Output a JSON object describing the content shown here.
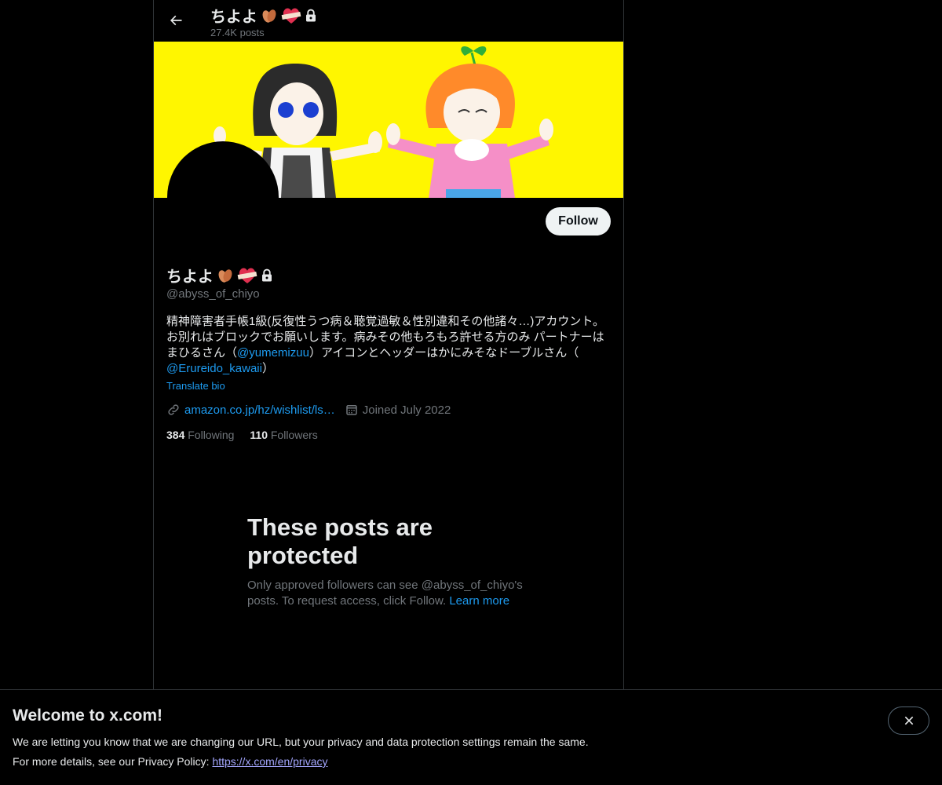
{
  "header": {
    "name": "ちよよ",
    "post_count": "27.4K posts"
  },
  "profile": {
    "name": "ちよよ",
    "handle": "@abyss_of_chiyo",
    "follow_label": "Follow",
    "bio_line1": "精神障害者手帳1級(反復性うつ病＆聴覚過敏＆性別違和その他諸々…)アカウント。",
    "bio_line2": "お別れはブロックでお願いします。病みその他もろもろ許せる方のみ パートナーは",
    "bio_line3_pre": "まひるさん（",
    "bio_mention1": "@yumemizuu",
    "bio_line3_post": "）アイコンとヘッダーはかにみそなドーブルさん（",
    "bio_mention2": "@Erureido_kawaii",
    "bio_line4_post": "）",
    "translate_label": "Translate bio",
    "website": "amazon.co.jp/hz/wishlist/ls…",
    "joined": "Joined July 2022",
    "following_count": "384",
    "following_label": "Following",
    "followers_count": "110",
    "followers_label": "Followers"
  },
  "protected": {
    "title": "These posts are protected",
    "text": "Only approved followers can see @abyss_of_chiyo's posts. To request access, click Follow.",
    "learn_more": "Learn more"
  },
  "notice": {
    "title": "Welcome to x.com!",
    "line1": "We are letting you know that we are changing our URL, but your privacy and data protection settings remain the same.",
    "line2_pre": "For more details, see our Privacy Policy: ",
    "link": "https://x.com/en/privacy"
  },
  "icons": [
    "back-arrow-icon",
    "lock-icon",
    "leaf-emoji-icon",
    "heart-bandage-emoji-icon",
    "link-icon",
    "calendar-icon",
    "close-icon"
  ],
  "colors": {
    "accent": "#1d9bf0",
    "banner": "#fff600",
    "muted": "#71767b"
  }
}
